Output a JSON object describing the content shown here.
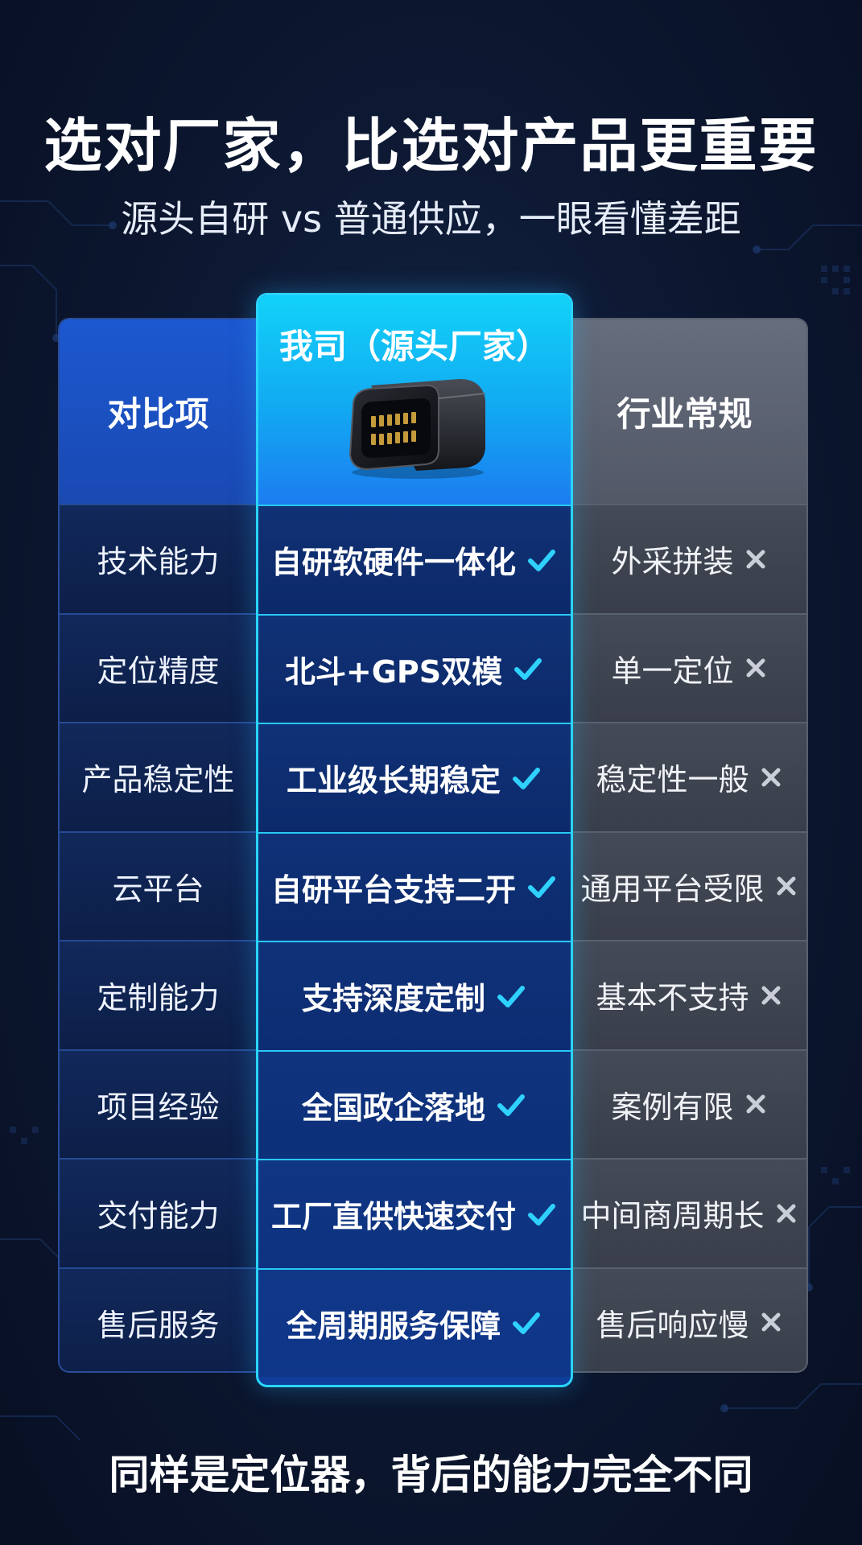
{
  "header": {
    "title": "选对厂家，比选对产品更重要",
    "subtitle": "源头自研 vs 普通供应，一眼看懂差距"
  },
  "table": {
    "col_labels": {
      "item": "对比项",
      "ours": "我司（源头厂家）",
      "industry": "行业常规"
    },
    "rows": [
      {
        "item": "技术能力",
        "ours": "自研软硬件一体化",
        "industry": "外采拼装"
      },
      {
        "item": "定位精度",
        "ours": "北斗+GPS双模",
        "industry": "单一定位"
      },
      {
        "item": "产品稳定性",
        "ours": "工业级长期稳定",
        "industry": "稳定性一般"
      },
      {
        "item": "云平台",
        "ours": "自研平台支持二开",
        "industry": "通用平台受限"
      },
      {
        "item": "定制能力",
        "ours": "支持深度定制",
        "industry": "基本不支持"
      },
      {
        "item": "项目经验",
        "ours": "全国政企落地",
        "industry": "案例有限"
      },
      {
        "item": "交付能力",
        "ours": "工厂直供快速交付",
        "industry": "中间商周期长"
      },
      {
        "item": "售后服务",
        "ours": "全周期服务保障",
        "industry": "售后响应慢"
      }
    ],
    "icons": {
      "ours": "check-icon",
      "industry": "cross-icon",
      "device": "obd-device-icon"
    },
    "colors": {
      "accent": "#29d4ff",
      "check": "#2fd2ff",
      "cross": "#c9ced8"
    }
  },
  "footer": {
    "text": "同样是定位器，背后的能力完全不同"
  }
}
